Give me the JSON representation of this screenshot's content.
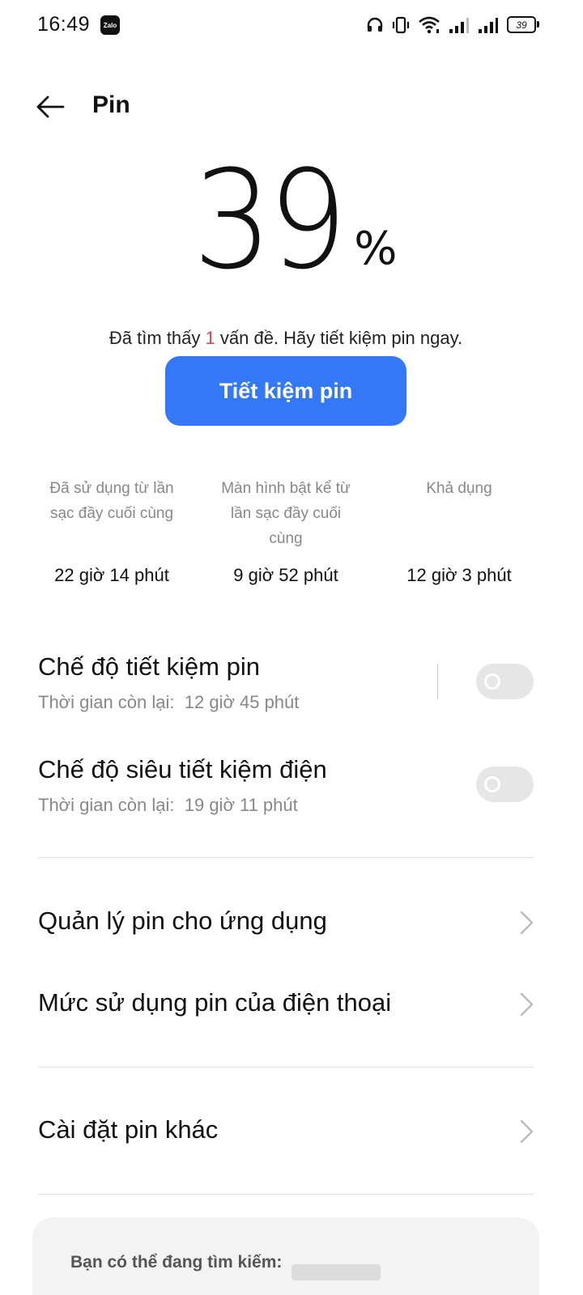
{
  "status_bar": {
    "time": "16:49",
    "app_icon_text": "Zalo",
    "battery_level": "39",
    "icons": [
      "headset-icon",
      "vibrate-icon",
      "wifi-icon",
      "signal-1-icon",
      "signal-2-icon",
      "battery-icon"
    ]
  },
  "header": {
    "title": "Pin"
  },
  "battery": {
    "percent": "39",
    "unit": "%"
  },
  "issue": {
    "prefix": "Đã tìm thấy ",
    "count": "1",
    "suffix": " vấn đề. Hãy tiết kiệm pin ngay."
  },
  "save_button_label": "Tiết kiệm pin",
  "stats": [
    {
      "label": "Đã sử dụng từ lần sạc đầy cuối cùng",
      "value": "22 giờ 14 phút"
    },
    {
      "label": "Màn hình bật kể từ lần sạc đầy cuối cùng",
      "value": "9 giờ 52 phút"
    },
    {
      "label": "Khả dụng",
      "value": "12 giờ 3 phút"
    }
  ],
  "modes": [
    {
      "title": "Chế độ tiết kiệm pin",
      "subtitle": "Thời gian còn lại:  12 giờ 45 phút",
      "enabled": false
    },
    {
      "title": "Chế độ siêu tiết kiệm điện",
      "subtitle": "Thời gian còn lại:  19 giờ 11 phút",
      "enabled": false
    }
  ],
  "menu": [
    {
      "label": "Quản lý pin cho ứng dụng"
    },
    {
      "label": "Mức sử dụng pin của điện thoại"
    },
    {
      "label": "Cài đặt pin khác"
    }
  ],
  "suggestions": {
    "label": "Bạn có thể đang tìm kiếm:"
  },
  "colors": {
    "accent": "#3478f6",
    "issue_count": "#e0455a",
    "toggle_off": "#e6e6e6"
  }
}
